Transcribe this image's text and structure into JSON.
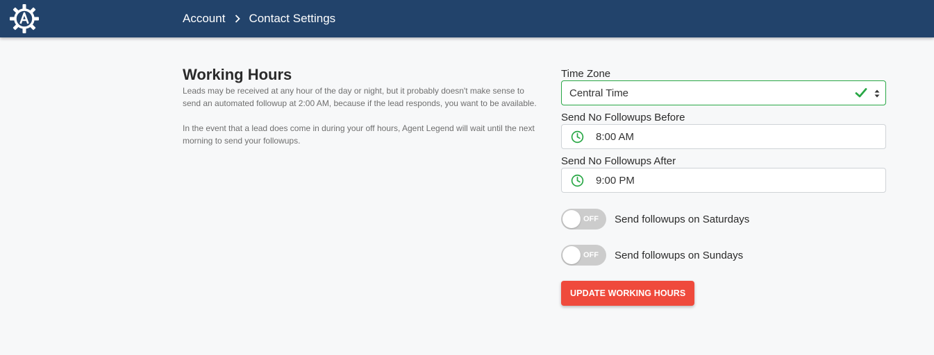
{
  "header": {
    "logo": "agent-legend-gear-logo",
    "breadcrumb": [
      "Account",
      "Contact Settings"
    ],
    "background_color": "#22436b"
  },
  "working_hours": {
    "title": "Working Hours",
    "description_1": "Leads may be received at any hour of the day or night, but it probably doesn't make sense to send an automated followup at 2:00 AM, because if the lead responds, you want to be available.",
    "description_2": "In the event that a lead does come in during your off hours, Agent Legend will wait until the next morning to send your followups."
  },
  "form": {
    "timezone_label": "Time Zone",
    "timezone_value": "Central Time",
    "before_label": "Send No Followups Before",
    "before_value": "8:00 AM",
    "after_label": "Send No Followups After",
    "after_value": "9:00 PM",
    "saturday_toggle_state": "OFF",
    "saturday_label": "Send followups on Saturdays",
    "sunday_toggle_state": "OFF",
    "sunday_label": "Send followups on Sundays",
    "submit_label": "UPDATE WORKING HOURS"
  },
  "colors": {
    "accent_button": "#ef4a3c",
    "valid_green": "#28a745",
    "toggle_off": "#cccccc"
  }
}
